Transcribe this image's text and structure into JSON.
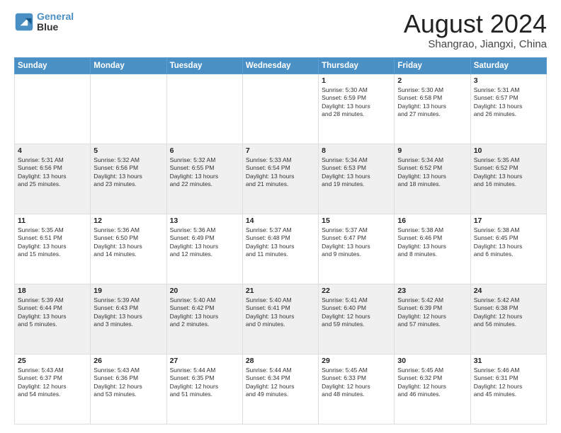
{
  "logo": {
    "line1": "General",
    "line2": "Blue"
  },
  "title": "August 2024",
  "location": "Shangrao, Jiangxi, China",
  "days_header": [
    "Sunday",
    "Monday",
    "Tuesday",
    "Wednesday",
    "Thursday",
    "Friday",
    "Saturday"
  ],
  "weeks": [
    [
      {
        "day": "",
        "info": ""
      },
      {
        "day": "",
        "info": ""
      },
      {
        "day": "",
        "info": ""
      },
      {
        "day": "",
        "info": ""
      },
      {
        "day": "1",
        "info": "Sunrise: 5:30 AM\nSunset: 6:59 PM\nDaylight: 13 hours\nand 28 minutes."
      },
      {
        "day": "2",
        "info": "Sunrise: 5:30 AM\nSunset: 6:58 PM\nDaylight: 13 hours\nand 27 minutes."
      },
      {
        "day": "3",
        "info": "Sunrise: 5:31 AM\nSunset: 6:57 PM\nDaylight: 13 hours\nand 26 minutes."
      }
    ],
    [
      {
        "day": "4",
        "info": "Sunrise: 5:31 AM\nSunset: 6:56 PM\nDaylight: 13 hours\nand 25 minutes."
      },
      {
        "day": "5",
        "info": "Sunrise: 5:32 AM\nSunset: 6:56 PM\nDaylight: 13 hours\nand 23 minutes."
      },
      {
        "day": "6",
        "info": "Sunrise: 5:32 AM\nSunset: 6:55 PM\nDaylight: 13 hours\nand 22 minutes."
      },
      {
        "day": "7",
        "info": "Sunrise: 5:33 AM\nSunset: 6:54 PM\nDaylight: 13 hours\nand 21 minutes."
      },
      {
        "day": "8",
        "info": "Sunrise: 5:34 AM\nSunset: 6:53 PM\nDaylight: 13 hours\nand 19 minutes."
      },
      {
        "day": "9",
        "info": "Sunrise: 5:34 AM\nSunset: 6:52 PM\nDaylight: 13 hours\nand 18 minutes."
      },
      {
        "day": "10",
        "info": "Sunrise: 5:35 AM\nSunset: 6:52 PM\nDaylight: 13 hours\nand 16 minutes."
      }
    ],
    [
      {
        "day": "11",
        "info": "Sunrise: 5:35 AM\nSunset: 6:51 PM\nDaylight: 13 hours\nand 15 minutes."
      },
      {
        "day": "12",
        "info": "Sunrise: 5:36 AM\nSunset: 6:50 PM\nDaylight: 13 hours\nand 14 minutes."
      },
      {
        "day": "13",
        "info": "Sunrise: 5:36 AM\nSunset: 6:49 PM\nDaylight: 13 hours\nand 12 minutes."
      },
      {
        "day": "14",
        "info": "Sunrise: 5:37 AM\nSunset: 6:48 PM\nDaylight: 13 hours\nand 11 minutes."
      },
      {
        "day": "15",
        "info": "Sunrise: 5:37 AM\nSunset: 6:47 PM\nDaylight: 13 hours\nand 9 minutes."
      },
      {
        "day": "16",
        "info": "Sunrise: 5:38 AM\nSunset: 6:46 PM\nDaylight: 13 hours\nand 8 minutes."
      },
      {
        "day": "17",
        "info": "Sunrise: 5:38 AM\nSunset: 6:45 PM\nDaylight: 13 hours\nand 6 minutes."
      }
    ],
    [
      {
        "day": "18",
        "info": "Sunrise: 5:39 AM\nSunset: 6:44 PM\nDaylight: 13 hours\nand 5 minutes."
      },
      {
        "day": "19",
        "info": "Sunrise: 5:39 AM\nSunset: 6:43 PM\nDaylight: 13 hours\nand 3 minutes."
      },
      {
        "day": "20",
        "info": "Sunrise: 5:40 AM\nSunset: 6:42 PM\nDaylight: 13 hours\nand 2 minutes."
      },
      {
        "day": "21",
        "info": "Sunrise: 5:40 AM\nSunset: 6:41 PM\nDaylight: 13 hours\nand 0 minutes."
      },
      {
        "day": "22",
        "info": "Sunrise: 5:41 AM\nSunset: 6:40 PM\nDaylight: 12 hours\nand 59 minutes."
      },
      {
        "day": "23",
        "info": "Sunrise: 5:42 AM\nSunset: 6:39 PM\nDaylight: 12 hours\nand 57 minutes."
      },
      {
        "day": "24",
        "info": "Sunrise: 5:42 AM\nSunset: 6:38 PM\nDaylight: 12 hours\nand 56 minutes."
      }
    ],
    [
      {
        "day": "25",
        "info": "Sunrise: 5:43 AM\nSunset: 6:37 PM\nDaylight: 12 hours\nand 54 minutes."
      },
      {
        "day": "26",
        "info": "Sunrise: 5:43 AM\nSunset: 6:36 PM\nDaylight: 12 hours\nand 53 minutes."
      },
      {
        "day": "27",
        "info": "Sunrise: 5:44 AM\nSunset: 6:35 PM\nDaylight: 12 hours\nand 51 minutes."
      },
      {
        "day": "28",
        "info": "Sunrise: 5:44 AM\nSunset: 6:34 PM\nDaylight: 12 hours\nand 49 minutes."
      },
      {
        "day": "29",
        "info": "Sunrise: 5:45 AM\nSunset: 6:33 PM\nDaylight: 12 hours\nand 48 minutes."
      },
      {
        "day": "30",
        "info": "Sunrise: 5:45 AM\nSunset: 6:32 PM\nDaylight: 12 hours\nand 46 minutes."
      },
      {
        "day": "31",
        "info": "Sunrise: 5:46 AM\nSunset: 6:31 PM\nDaylight: 12 hours\nand 45 minutes."
      }
    ]
  ]
}
